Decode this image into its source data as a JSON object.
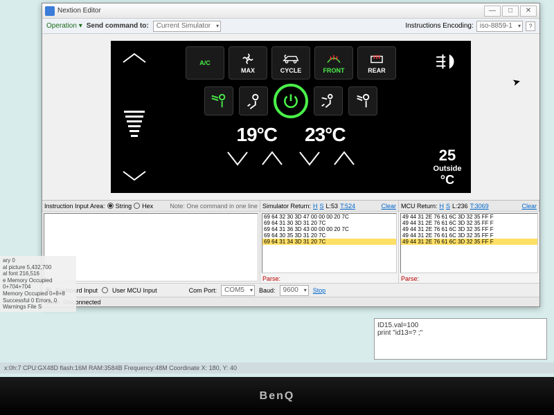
{
  "window": {
    "title": "Nextion Editor",
    "min": "—",
    "max": "□",
    "close": "✕"
  },
  "toolbar": {
    "operation": "Operation ▾",
    "send_label": "Send command to:",
    "send_target": "Current Simulator",
    "encoding_label": "Instructions Encoding:",
    "encoding_value": "iso-8859-1"
  },
  "hmi": {
    "ac_label": "A/C",
    "buttons": [
      {
        "label": "MAX",
        "icon": "fan"
      },
      {
        "label": "CYCLE",
        "icon": "car"
      },
      {
        "label": "FRONT",
        "icon": "defrost-front",
        "green": true
      },
      {
        "label": "REAR",
        "icon": "defrost-rear"
      }
    ],
    "temp_left": "19°C",
    "temp_right": "23°C",
    "outside_val": "25",
    "outside_label": "Outside",
    "outside_unit": "°C"
  },
  "panels": {
    "input_label": "Instruction Input Area:",
    "string": "String",
    "hex": "Hex",
    "note": "Note: One command in one line",
    "sim_return": "Simulator Return:",
    "mcu_return": "MCU Return:",
    "H": "H",
    "S": "S",
    "sim_line": "L:53",
    "sim_total": "T:524",
    "mcu_line": "L:236",
    "mcu_total": "T:3069",
    "clear": "Clear",
    "parse": "Parse:",
    "sim_rows": [
      "69 64 32 30 3D 47 00 00 00 20 7C",
      "69 64 31 30 3D 31 20 7C",
      "69 64 31 36 3D 43 00 00 00 20 7C",
      "69 64 30 35 3D 31 20 7C",
      "69 64 31 34 3D 31 20 7C"
    ],
    "mcu_rows": [
      "49 44 31 2E 76 61 6C 3D 32 35 FF F",
      "49 44 31 2E 76 61 6C 3D 32 35 FF F",
      "49 44 31 2E 76 61 6C 3D 32 35 FF F",
      "49 44 31 2E 76 61 6C 3D 32 35 FF F",
      "49 44 31 2E 76 61 6C 3D 32 35 FF F"
    ]
  },
  "controls": {
    "keyboard": "Keyboard Input",
    "user_mcu": "User MCU Input",
    "comport_label": "Com Port:",
    "comport": "COM5",
    "baud_label": "Baud:",
    "baud": "9600",
    "stop": "Stop"
  },
  "status": "State: Disconnected",
  "info": {
    "l1": "ary 0",
    "l2": "al picture 5,432,700",
    "l3": "al font 216,516",
    "l4": "e Memory Occupied 0+704+704",
    "l5": "Memory Occupied 0+8+8",
    "l6": "Successful 0 Errors, 0 Warnings File S"
  },
  "script": {
    "l1": "ID15.val=100",
    "l2": "print \"id13=? ;\""
  },
  "footer": "x:0h:7 CPU:GX48D flash:16M RAM:3584B Frequency:48M    Coordinate X: 180, Y: 40",
  "monitor": "BenQ"
}
